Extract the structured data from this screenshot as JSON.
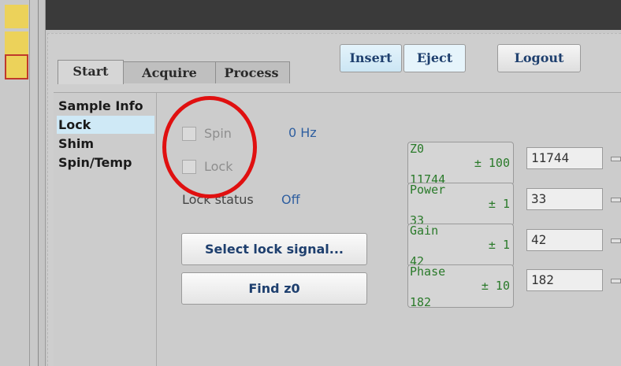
{
  "tabs": [
    {
      "label": "Start"
    },
    {
      "label": "Acquire"
    },
    {
      "label": "Process"
    }
  ],
  "header_buttons": {
    "insert": "Insert",
    "eject": "Eject",
    "logout": "Logout"
  },
  "sidebar": {
    "items": [
      {
        "label": "Sample Info"
      },
      {
        "label": "Lock"
      },
      {
        "label": "Shim"
      },
      {
        "label": "Spin/Temp"
      }
    ],
    "selected": "Lock"
  },
  "lock_panel": {
    "spin_label": "Spin",
    "spin_rate": "0 Hz",
    "lock_label": "Lock",
    "lock_status_label": "Lock status",
    "lock_status_value": "Off",
    "select_lock_signal_button": "Select lock signal...",
    "find_z0_button": "Find z0"
  },
  "parameters": [
    {
      "name": "Z0",
      "current": "11744",
      "step": "± 100",
      "field_value": "11744"
    },
    {
      "name": "Power",
      "current": "33",
      "step": "± 1",
      "field_value": "33"
    },
    {
      "name": "Gain",
      "current": "42",
      "step": "± 1",
      "field_value": "42"
    },
    {
      "name": "Phase",
      "current": "182",
      "step": "± 10",
      "field_value": "182"
    }
  ],
  "colors": {
    "accent_blue": "#2f5fa0",
    "param_green": "#2a7a2a",
    "highlight_red": "#e01010",
    "selected_bg": "#cfe9f6"
  }
}
